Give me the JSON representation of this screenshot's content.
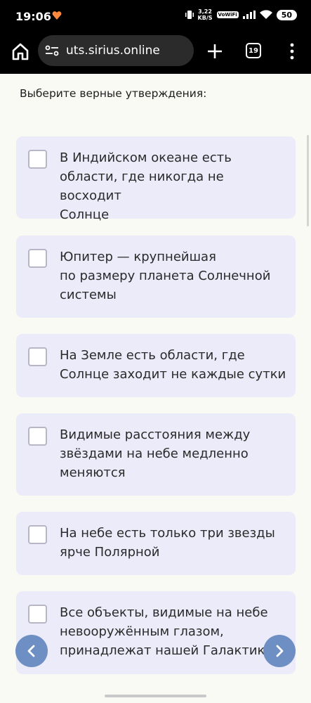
{
  "status_bar": {
    "time": "19:06",
    "net_speed_value": "3,22",
    "net_speed_unit": "KB/S",
    "volte": "VoWiFi",
    "battery": "50"
  },
  "browser": {
    "url": "uts.sirius.online",
    "tab_count": "19",
    "icons": [
      "home-icon",
      "site-settings-icon",
      "plus-icon",
      "tabs-icon",
      "more-vert-icon"
    ]
  },
  "quiz": {
    "question": "Выберите верные утверждения:",
    "options": [
      {
        "text": "В Индийском океане есть\nобласти, где никогда не восходит\nСолнце",
        "checked": false
      },
      {
        "text": "Юпитер — крупнейшая\nпо размеру планета Солнечной\nсистемы",
        "checked": false
      },
      {
        "text": "На Земле есть области, где\nСолнце заходит не каждые сутки",
        "checked": false
      },
      {
        "text": "Видимые расстояния между\nзвёздами на небе медленно\nменяются",
        "checked": false
      },
      {
        "text": "На небе есть только три звезды\nярче Полярной",
        "checked": false
      },
      {
        "text": "Все объекты, видимые на небе\nневооружённым глазом,\nпринадлежат нашей Галактике",
        "checked": false
      }
    ]
  },
  "navigation": {
    "prev_icon": "chevron-left-icon",
    "next_icon": "chevron-right-icon"
  },
  "colors": {
    "option_bg": "#ecebfa",
    "nav_button": "#6e8fc4",
    "page_bg": "#fafaf5"
  }
}
